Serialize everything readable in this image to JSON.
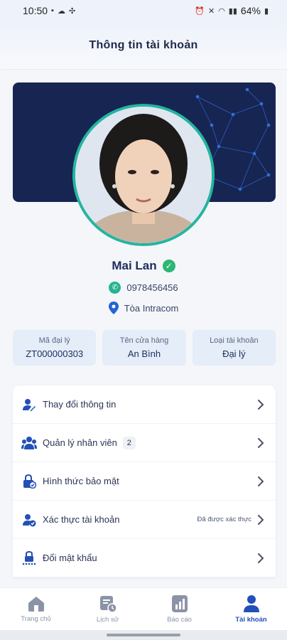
{
  "status_bar": {
    "time": "10:50",
    "battery": "64%"
  },
  "header": {
    "title": "Thông tin tài khoản"
  },
  "profile": {
    "name": "Mai Lan",
    "phone": "0978456456",
    "address": "Tòa Intracom"
  },
  "info_cards": [
    {
      "label": "Mã đại lý",
      "value": "ZT000000303"
    },
    {
      "label": "Tên cửa hàng",
      "value": "An Bình"
    },
    {
      "label": "Loại tài khoản",
      "value": "Đại lý"
    }
  ],
  "menu": {
    "items": [
      {
        "label": "Thay đổi thông tin",
        "icon": "user-edit-icon"
      },
      {
        "label": "Quản lý nhân viên",
        "icon": "users-icon",
        "badge": "2"
      },
      {
        "label": "Hình thức bảo mật",
        "icon": "lock-icon"
      },
      {
        "label": "Xác thực tài khoản",
        "icon": "user-check-icon",
        "status": "Đã được xác thực"
      },
      {
        "label": "Đổi mật khẩu",
        "icon": "password-lock-icon"
      }
    ]
  },
  "tabbar": {
    "tabs": [
      {
        "label": "Trang chủ",
        "icon": "home-icon"
      },
      {
        "label": "Lịch sử",
        "icon": "history-icon"
      },
      {
        "label": "Báo cáo",
        "icon": "report-icon"
      },
      {
        "label": "Tài khoản",
        "icon": "account-icon",
        "active": true
      }
    ]
  },
  "colors": {
    "primary": "#2350b8",
    "banner": "#172552",
    "avatar_ring": "#23b5a0",
    "verified": "#2bb673"
  }
}
